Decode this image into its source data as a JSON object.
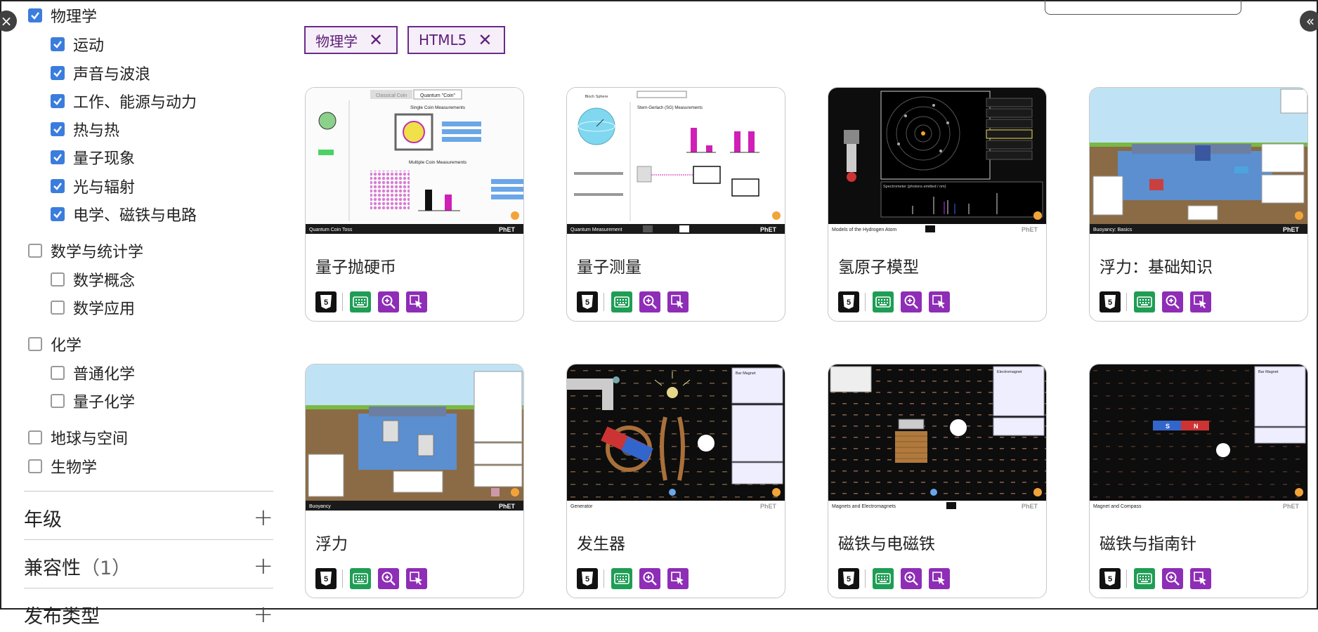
{
  "sidebar": {
    "physics": {
      "label": "物理学",
      "checked": true
    },
    "physics_children": [
      {
        "label": "运动",
        "checked": true
      },
      {
        "label": "声音与波浪",
        "checked": true
      },
      {
        "label": "工作、能源与动力",
        "checked": true
      },
      {
        "label": "热与热",
        "checked": true
      },
      {
        "label": "量子现象",
        "checked": true
      },
      {
        "label": "光与辐射",
        "checked": true
      },
      {
        "label": "电学、磁铁与电路",
        "checked": true
      }
    ],
    "math": {
      "label": "数学与统计学",
      "checked": false
    },
    "math_children": [
      {
        "label": "数学概念",
        "checked": false
      },
      {
        "label": "数学应用",
        "checked": false
      }
    ],
    "chemistry": {
      "label": "化学",
      "checked": false
    },
    "chemistry_children": [
      {
        "label": "普通化学",
        "checked": false
      },
      {
        "label": "量子化学",
        "checked": false
      }
    ],
    "earth": {
      "label": "地球与空间",
      "checked": false
    },
    "biology": {
      "label": "生物学",
      "checked": false
    },
    "grade": {
      "label": "年级"
    },
    "compat": {
      "label": "兼容性",
      "count": "（1）"
    },
    "publish": {
      "label": "发布类型"
    }
  },
  "controls": {
    "close_icon": "×",
    "collapse_icon": "«",
    "plus": "+"
  },
  "filters": {
    "chips": [
      "物理学",
      "HTML5"
    ],
    "chip_close": "✕"
  },
  "sims": [
    {
      "title": "量子抛硬币",
      "caption": "Quantum Coin Toss"
    },
    {
      "title": "量子测量",
      "caption": "Quantum Measurement"
    },
    {
      "title": "氢原子模型",
      "caption": "Models of the Hydrogen Atom"
    },
    {
      "title": "浮力：基础知识",
      "caption": "Buoyancy: Basics"
    },
    {
      "title": "浮力",
      "caption": "Buoyancy"
    },
    {
      "title": "发生器",
      "caption": "Generator"
    },
    {
      "title": "磁铁与电磁铁",
      "caption": "Magnets and Electromagnets"
    },
    {
      "title": "磁铁与指南针",
      "caption": "Magnet and Compass"
    }
  ],
  "thumb_text": {
    "phet": "PhET",
    "coin_tabs": [
      "Classical Coin",
      "Quantum \"Coin\""
    ],
    "coin_single": "Single Coin Measurements",
    "coin_multiple": "Multiple Coin Measurements",
    "sg_title": "Stern-Gerlach (SG) Measurements",
    "bloch": "Bloch Sphere",
    "hydrogen_spectrum": "Spectrometer (photons emitted / nm)",
    "bar_magnet": "Bar Magnet",
    "electromagnet": "Electromagnet"
  },
  "colors": {
    "accent": "#6a2b8c",
    "checkbox": "#3b7ddd",
    "keyboard_badge": "#1f9d55",
    "zoom_badge": "#8e2db6"
  }
}
